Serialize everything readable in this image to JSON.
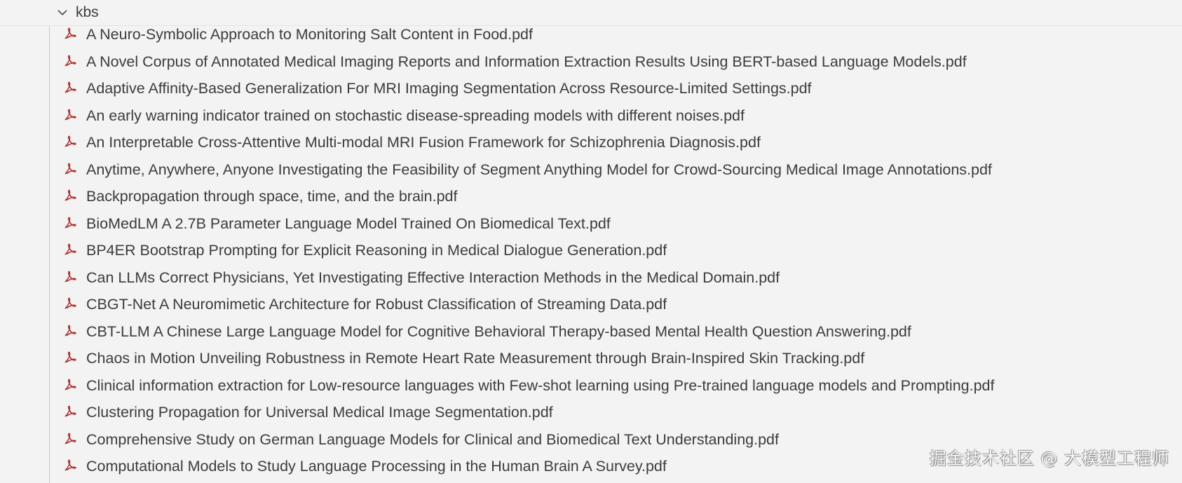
{
  "folder": {
    "name": "kbs",
    "chevron_icon": "chevron-down-icon"
  },
  "file_icon": "pdf-icon",
  "colors": {
    "background": "#f3f3f3",
    "pdf_icon": "#b12a2a",
    "text": "#3c3c3c"
  },
  "files": [
    {
      "name": "A Neuro-Symbolic Approach to Monitoring Salt Content in Food.pdf"
    },
    {
      "name": "A Novel Corpus of Annotated Medical Imaging Reports and Information Extraction Results Using BERT-based Language Models.pdf"
    },
    {
      "name": "Adaptive Affinity-Based Generalization For MRI Imaging Segmentation Across Resource-Limited Settings.pdf"
    },
    {
      "name": "An early warning indicator trained on stochastic disease-spreading models with different noises.pdf"
    },
    {
      "name": "An Interpretable Cross-Attentive Multi-modal MRI Fusion Framework for Schizophrenia Diagnosis.pdf"
    },
    {
      "name": "Anytime, Anywhere, Anyone Investigating the Feasibility of Segment Anything Model for Crowd-Sourcing Medical Image Annotations.pdf"
    },
    {
      "name": "Backpropagation through space, time, and the brain.pdf"
    },
    {
      "name": "BioMedLM A 2.7B Parameter Language Model Trained On Biomedical Text.pdf"
    },
    {
      "name": "BP4ER Bootstrap Prompting for Explicit Reasoning in Medical Dialogue Generation.pdf"
    },
    {
      "name": "Can LLMs Correct Physicians, Yet Investigating Effective Interaction Methods in the Medical Domain.pdf"
    },
    {
      "name": "CBGT-Net A Neuromimetic Architecture for Robust Classification of Streaming Data.pdf"
    },
    {
      "name": "CBT-LLM A Chinese Large Language Model for Cognitive Behavioral Therapy-based Mental Health Question Answering.pdf"
    },
    {
      "name": "Chaos in Motion Unveiling Robustness in Remote Heart Rate Measurement through Brain-Inspired Skin Tracking.pdf"
    },
    {
      "name": "Clinical information extraction for Low-resource languages with Few-shot learning using Pre-trained language models and Prompting.pdf"
    },
    {
      "name": "Clustering Propagation for Universal Medical Image Segmentation.pdf"
    },
    {
      "name": "Comprehensive Study on German Language Models for Clinical and Biomedical Text Understanding.pdf"
    },
    {
      "name": "Computational Models to Study Language Processing in the Human Brain A Survey.pdf"
    }
  ],
  "watermark": "掘金技术社区 @ 大模型工程师"
}
